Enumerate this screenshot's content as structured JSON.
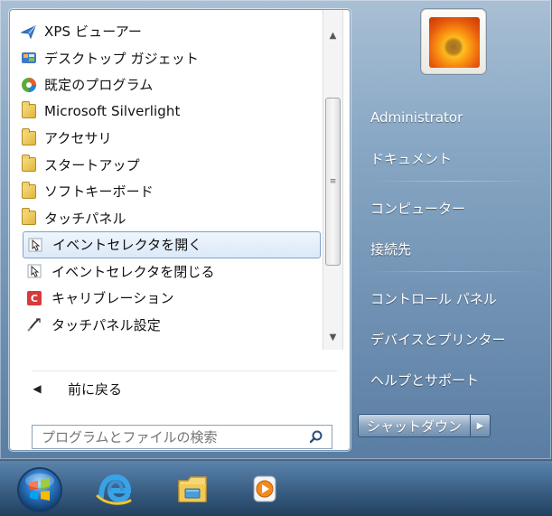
{
  "programs": [
    {
      "label": "XPS ビューアー",
      "icon": "xps-viewer-icon"
    },
    {
      "label": "デスクトップ ガジェット",
      "icon": "desktop-gadgets-icon"
    },
    {
      "label": "既定のプログラム",
      "icon": "default-programs-icon"
    },
    {
      "label": "Microsoft Silverlight",
      "icon": "folder-icon"
    },
    {
      "label": "アクセサリ",
      "icon": "folder-icon"
    },
    {
      "label": "スタートアップ",
      "icon": "folder-icon"
    },
    {
      "label": "ソフトキーボード",
      "icon": "folder-icon"
    },
    {
      "label": "タッチパネル",
      "icon": "folder-icon"
    },
    {
      "label": "イベントセレクタを開く",
      "icon": "event-selector-open-icon",
      "highlighted": true
    },
    {
      "label": "イベントセレクタを閉じる",
      "icon": "event-selector-close-icon"
    },
    {
      "label": "キャリブレーション",
      "icon": "calibration-icon"
    },
    {
      "label": "タッチパネル設定",
      "icon": "touch-panel-settings-icon"
    }
  ],
  "back_label": "前に戻る",
  "search": {
    "placeholder": "プログラムとファイルの検索"
  },
  "right_links": [
    "Administrator",
    "ドキュメント",
    "コンピューター",
    "接続先",
    "コントロール パネル",
    "デバイスとプリンター",
    "ヘルプとサポート"
  ],
  "shutdown": {
    "label": "シャットダウン"
  },
  "taskbar": {
    "items": [
      {
        "icon": "windows-start-icon"
      },
      {
        "icon": "internet-explorer-icon"
      },
      {
        "icon": "file-explorer-icon"
      },
      {
        "icon": "media-player-icon"
      }
    ]
  },
  "colors": {
    "highlight": "#dce9f8",
    "search_border": "#8aa3ba",
    "pane_blue": "#6c8fb4"
  }
}
